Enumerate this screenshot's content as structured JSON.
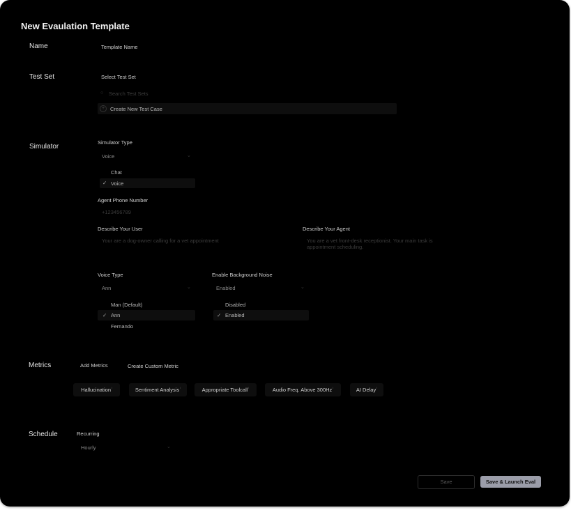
{
  "title": "New Evaulation Template",
  "name": {
    "section": "Name",
    "placeholder": "Template Name"
  },
  "test_set": {
    "section": "Test Set",
    "select_label": "Select Test Set",
    "search_placeholder": "Search Test Sets",
    "create_label": "Create New Test Case"
  },
  "simulator": {
    "section": "Simulator",
    "type_label": "Simulator Type",
    "type_value": "Voice",
    "type_options": [
      "Chat",
      "Voice"
    ],
    "phone_label": "Agent Phone Number",
    "phone_placeholder": "+123456789",
    "user_label": "Describe Your User",
    "user_placeholder": "Your are a dog-owner calling for a vet appointment",
    "agent_label": "Describe Your Agent",
    "agent_placeholder_1": "You are a vet front-desk receptionist. Your main task is",
    "agent_placeholder_2": "appointment scheduling.",
    "voice_label": "Voice Type",
    "voice_value": "Ann",
    "voice_options": [
      "Man (Default)",
      "Ann",
      "Fernando"
    ],
    "noise_label": "Enable Background Noise",
    "noise_value": "Enabled",
    "noise_options": [
      "Disabled",
      "Enabled"
    ]
  },
  "metrics": {
    "section": "Metrics",
    "add_label": "Add Metrics",
    "custom_label": "Create Custom Metric",
    "chips": [
      "Hallucination",
      "Sentiment Analysis",
      "Appropriate Toolcall",
      "Audio Freq. Above 300Hz",
      "AI Delay"
    ],
    "info_glyph": "i"
  },
  "schedule": {
    "section": "Schedule",
    "recurring_label": "Recurring",
    "value": "Hourly"
  },
  "footer": {
    "save": "Save",
    "launch": "Save & Launch Eval"
  },
  "icons": {
    "check": "✓",
    "chevron": "⌄",
    "plus": "+",
    "search": "○"
  }
}
